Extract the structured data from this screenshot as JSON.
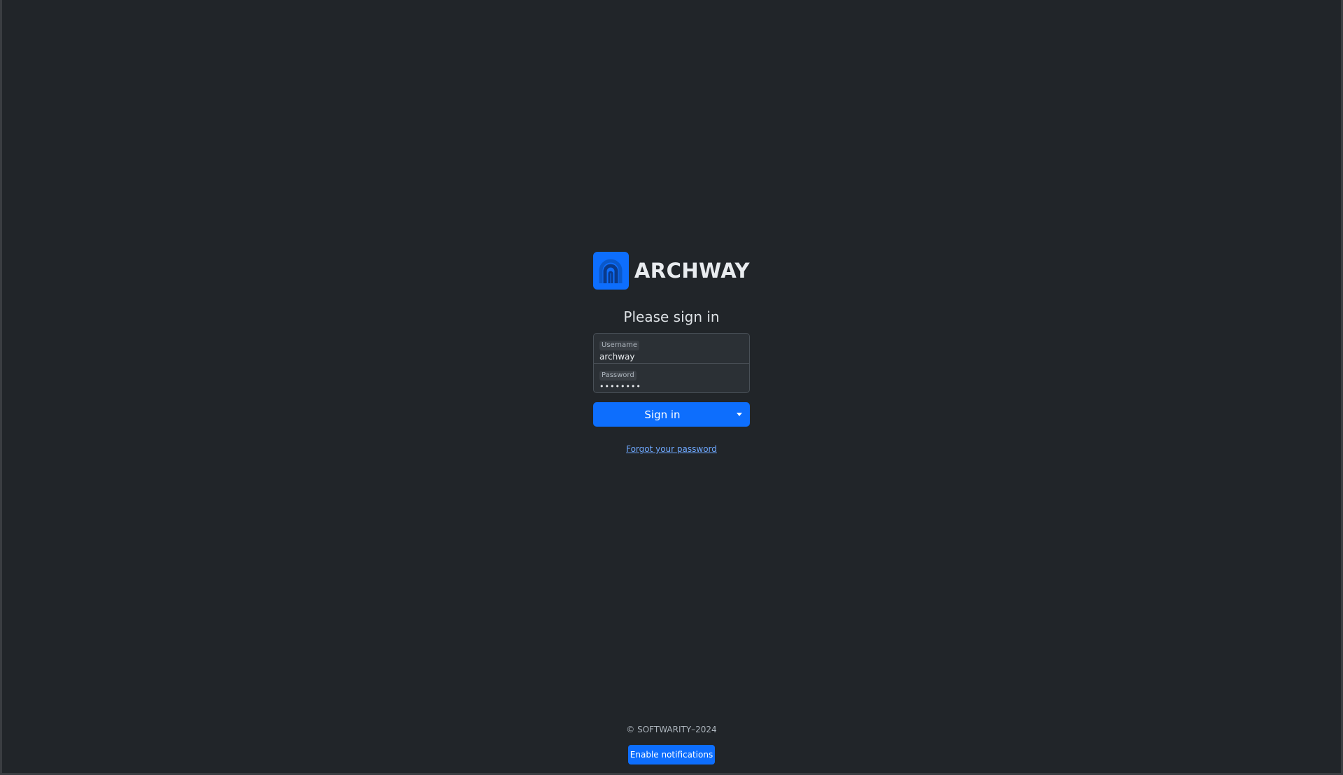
{
  "brand": {
    "name": "ARCHWAY",
    "logo_icon": "archway-arch-icon",
    "accent_color": "#0d6efd"
  },
  "signin": {
    "heading": "Please sign in",
    "username": {
      "label": "Username",
      "value": "archway"
    },
    "password": {
      "label": "Password",
      "value": "••••••••"
    },
    "submit_label": "Sign in",
    "dropdown_icon": "caret-down-icon",
    "forgot_link": "Forgot your password"
  },
  "footer": {
    "copyright": "© SOFTWARITY–2024",
    "notifications_button": "Enable notifications"
  }
}
